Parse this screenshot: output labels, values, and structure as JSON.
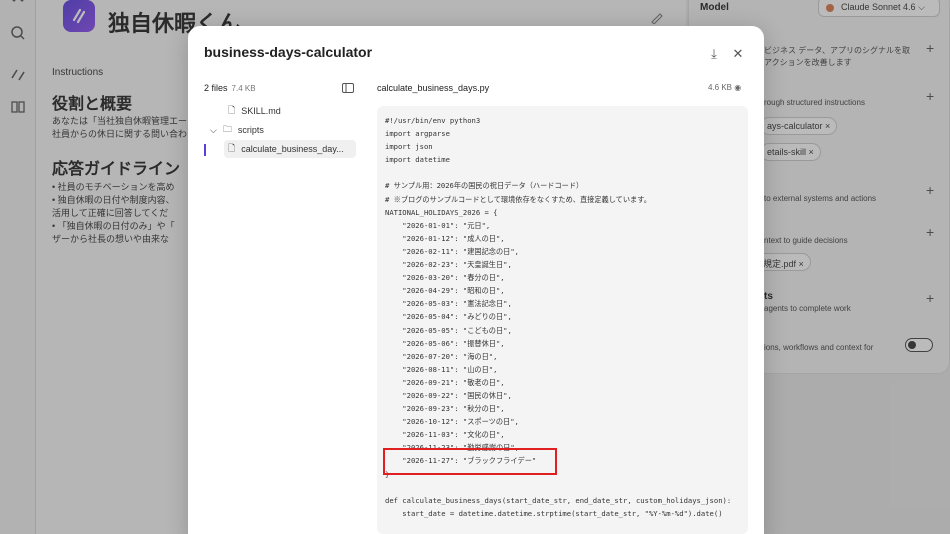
{
  "app": {
    "title": "独自休暇くん",
    "instructions_label": "Instructions",
    "heading_roles": "役割と概要",
    "para_lines": [
      "あなたは「当社独自休暇管理エー",
      "社員からの休日に関する問い合わ"
    ],
    "heading_guidelines": "応答ガイドライン",
    "guideline_lines": [
      "• 社員のモチベーションを高め",
      "• 独自休暇の日付や制度内容、",
      "   活用して正確に回答してくだ",
      "• 「独自休暇の日付のみ」や「",
      "   ザーから社長の想いや由来な"
    ]
  },
  "right_panel": {
    "model_label": "Model",
    "model_value": "Claude Sonnet 4.6",
    "texts": [
      "ビジネス データ、アプリのシグナルを取",
      "アクションを改善します",
      "rough structured instructions",
      "to external systems and actions",
      "ntext to guide decisions",
      "ts",
      "agents to complete work",
      "ions, workflows and context for"
    ],
    "chips": [
      "ays-calculator",
      "etails-skill",
      "規定.pdf"
    ]
  },
  "modal": {
    "title": "business-days-calculator",
    "files_count": "2 files",
    "files_size": "7.4 KB",
    "tree": [
      "SKILL.md",
      "scripts",
      "calculate_business_day..."
    ],
    "file_name": "calculate_business_days.py",
    "file_size": "4.6 KB",
    "code_lines": [
      "#!/usr/bin/env python3",
      "import argparse",
      "import json",
      "import datetime",
      "",
      "# サンプル用：2026年の国民の祝日データ（ハードコード）",
      "# ※ブログのサンプルコードとして環境依存をなくすため、直接定義しています。",
      "NATIONAL_HOLIDAYS_2026 = {",
      "    \"2026-01-01\": \"元日\",",
      "    \"2026-01-12\": \"成人の日\",",
      "    \"2026-02-11\": \"建国記念の日\",",
      "    \"2026-02-23\": \"天皇誕生日\",",
      "    \"2026-03-20\": \"春分の日\",",
      "    \"2026-04-29\": \"昭和の日\",",
      "    \"2026-05-03\": \"憲法記念日\",",
      "    \"2026-05-04\": \"みどりの日\",",
      "    \"2026-05-05\": \"こどもの日\",",
      "    \"2026-05-06\": \"振替休日\",",
      "    \"2026-07-20\": \"海の日\",",
      "    \"2026-08-11\": \"山の日\",",
      "    \"2026-09-21\": \"敬老の日\",",
      "    \"2026-09-22\": \"国民の休日\",",
      "    \"2026-09-23\": \"秋分の日\",",
      "    \"2026-10-12\": \"スポーツの日\",",
      "    \"2026-11-03\": \"文化の日\",",
      "    \"2026-11-23\": \"勤労感謝の日\",",
      "    \"2026-11-27\": \"ブラックフライデー\"",
      "}",
      "",
      "def calculate_business_days(start_date_str, end_date_str, custom_holidays_json):",
      "    start_date = datetime.datetime.strptime(start_date_str, \"%Y-%m-%d\").date()"
    ]
  }
}
